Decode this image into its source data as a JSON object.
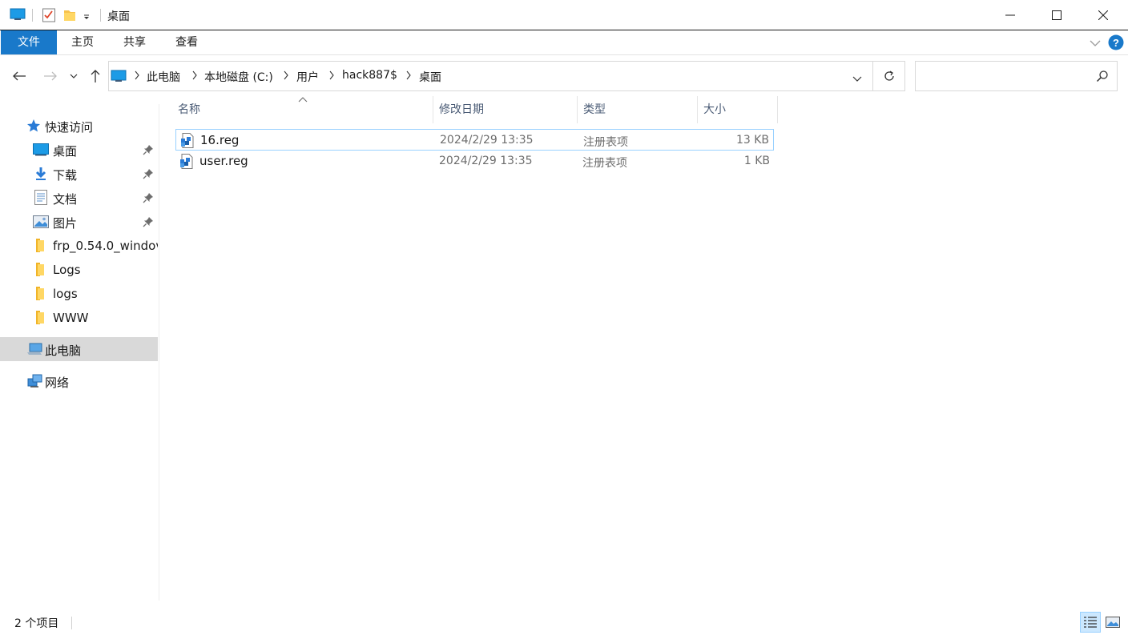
{
  "window": {
    "title": "桌面",
    "minimize_icon": "minimize-icon",
    "maximize_icon": "maximize-icon",
    "close_icon": "close-icon"
  },
  "ribbon": {
    "tabs": [
      {
        "label": "文件",
        "active": true
      },
      {
        "label": "主页"
      },
      {
        "label": "共享"
      },
      {
        "label": "查看"
      }
    ],
    "accent_color": "#1979ca"
  },
  "address": {
    "crumbs": [
      "此电脑",
      "本地磁盘 (C:)",
      "用户",
      "hack887$",
      "桌面"
    ],
    "search_placeholder": ""
  },
  "sidebar": {
    "quick_access": "快速访问",
    "items": [
      {
        "label": "桌面",
        "icon": "desktop-icon",
        "pinned": true
      },
      {
        "label": "下载",
        "icon": "download-icon",
        "pinned": true
      },
      {
        "label": "文档",
        "icon": "document-icon",
        "pinned": true
      },
      {
        "label": "图片",
        "icon": "pictures-icon",
        "pinned": true
      },
      {
        "label": "frp_0.54.0_windov",
        "icon": "folder-icon"
      },
      {
        "label": "Logs",
        "icon": "folder-icon"
      },
      {
        "label": "logs",
        "icon": "folder-icon"
      },
      {
        "label": "WWW",
        "icon": "folder-icon"
      }
    ],
    "this_pc": "此电脑",
    "network": "网络"
  },
  "columns": {
    "name": "名称",
    "date": "修改日期",
    "type": "类型",
    "size": "大小"
  },
  "files": [
    {
      "name": "16.reg",
      "date": "2024/2/29 13:35",
      "type": "注册表项",
      "size": "13 KB"
    },
    {
      "name": "user.reg",
      "date": "2024/2/29 13:35",
      "type": "注册表项",
      "size": "1 KB"
    }
  ],
  "status": {
    "count": "2 个项目"
  }
}
